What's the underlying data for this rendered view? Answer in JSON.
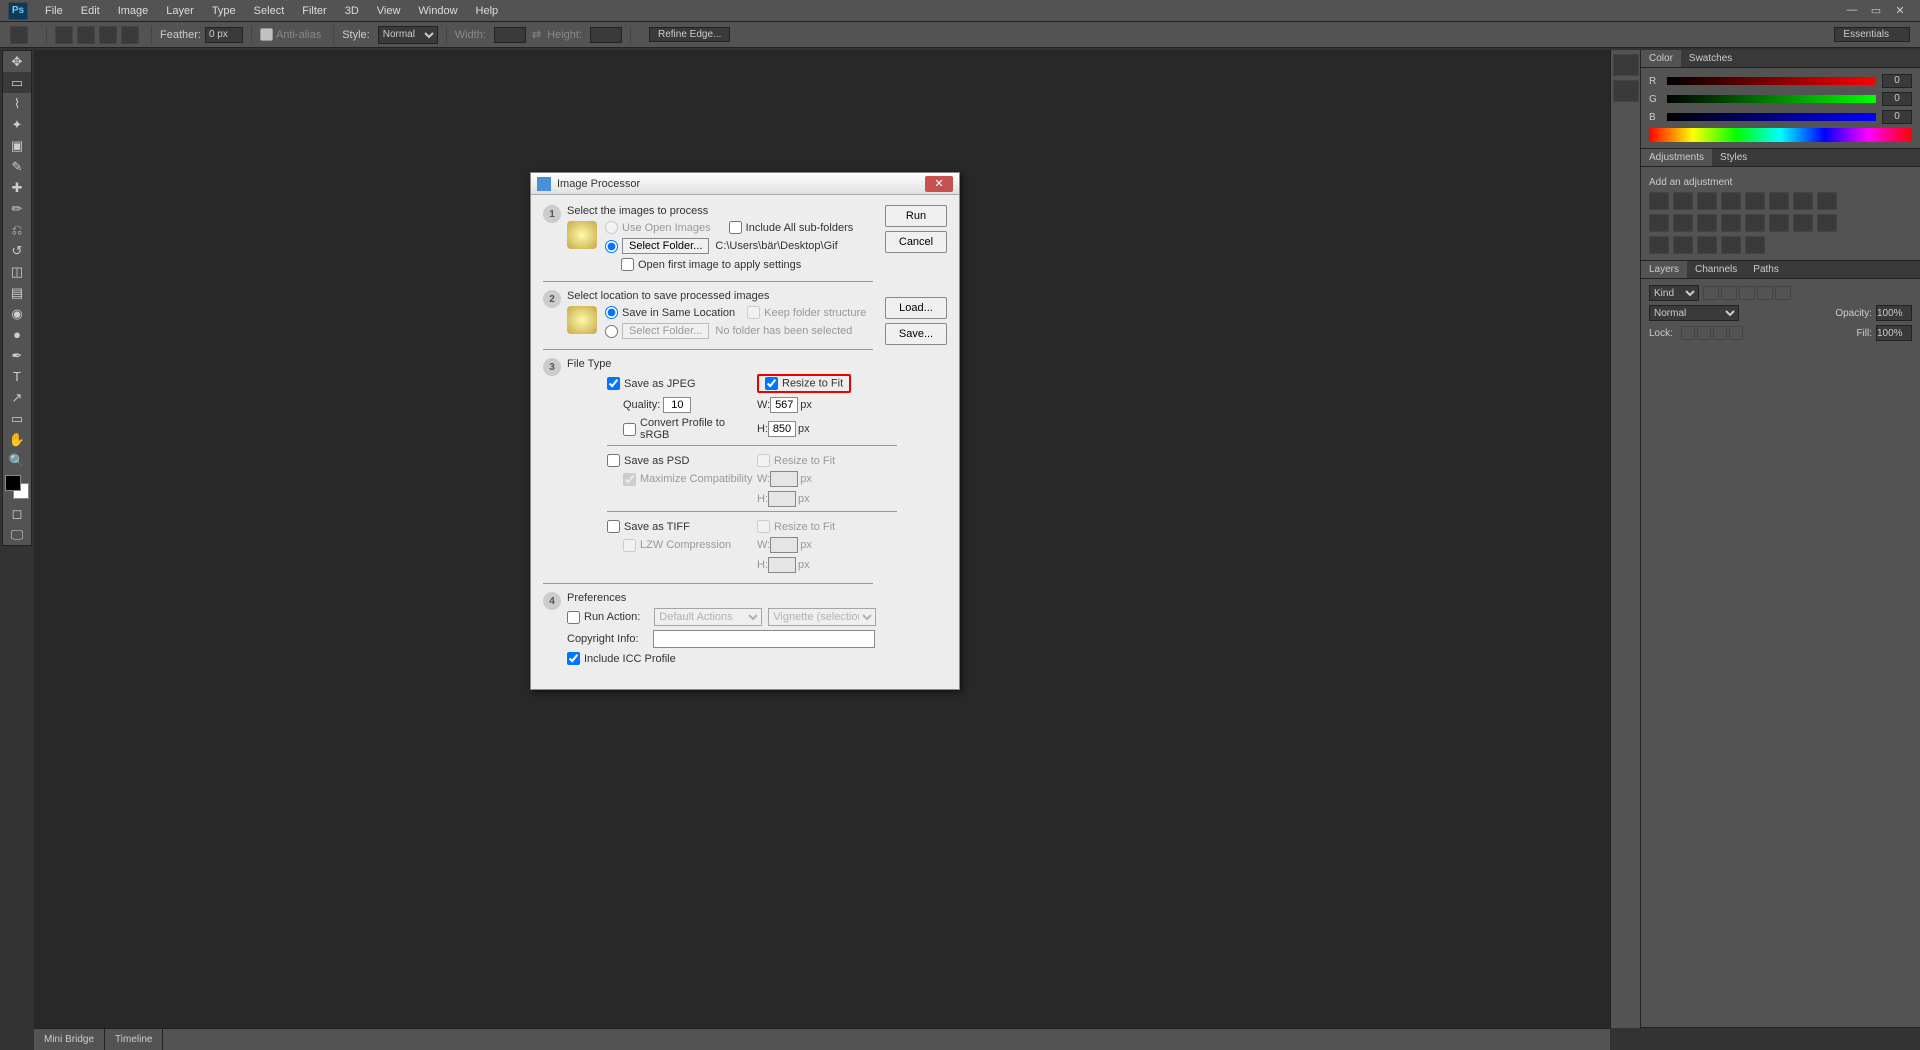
{
  "menu": [
    "File",
    "Edit",
    "Image",
    "Layer",
    "Type",
    "Select",
    "Filter",
    "3D",
    "View",
    "Window",
    "Help"
  ],
  "options": {
    "feather_label": "Feather:",
    "feather_value": "0 px",
    "antialias": "Anti-alias",
    "style_label": "Style:",
    "style_value": "Normal",
    "width_label": "Width:",
    "height_label": "Height:",
    "refine": "Refine Edge...",
    "workspace": "Essentials"
  },
  "panels": {
    "color_tab": "Color",
    "swatches_tab": "Swatches",
    "r_label": "R",
    "r_val": "0",
    "g_label": "G",
    "g_val": "0",
    "b_label": "B",
    "b_val": "0",
    "adjustments_tab": "Adjustments",
    "styles_tab": "Styles",
    "add_adj": "Add an adjustment",
    "layers_tab": "Layers",
    "channels_tab": "Channels",
    "paths_tab": "Paths",
    "kind": "Kind",
    "blend_mode": "Normal",
    "opacity_label": "Opacity:",
    "opacity_val": "100%",
    "lock_label": "Lock:",
    "fill_label": "Fill:",
    "fill_val": "100%"
  },
  "status": {
    "mini_bridge": "Mini Bridge",
    "timeline": "Timeline"
  },
  "dialog": {
    "title": "Image Processor",
    "btn_run": "Run",
    "btn_cancel": "Cancel",
    "btn_load": "Load...",
    "btn_save": "Save...",
    "sec1_head": "Select the images to process",
    "use_open": "Use Open Images",
    "include_sub": "Include All sub-folders",
    "select_folder": "Select Folder...",
    "folder_path": "C:\\Users\\bär\\Desktop\\Gif",
    "open_first": "Open first image to apply settings",
    "sec2_head": "Select location to save processed images",
    "save_same": "Save in Same Location",
    "keep_struct": "Keep folder structure",
    "no_folder": "No folder has been selected",
    "sec3_head": "File Type",
    "save_jpeg": "Save as JPEG",
    "resize_fit": "Resize to Fit",
    "quality_label": "Quality:",
    "quality_val": "10",
    "w_label": "W:",
    "h_label": "H:",
    "w_val": "567",
    "h_val": "850",
    "px": "px",
    "convert_srgb": "Convert Profile to sRGB",
    "save_psd": "Save as PSD",
    "max_compat": "Maximize Compatibility",
    "save_tiff": "Save as TIFF",
    "lzw": "LZW Compression",
    "sec4_head": "Preferences",
    "run_action": "Run Action:",
    "action_set": "Default Actions",
    "action_name": "Vignette (selection)",
    "copyright_label": "Copyright Info:",
    "include_icc": "Include ICC Profile"
  }
}
